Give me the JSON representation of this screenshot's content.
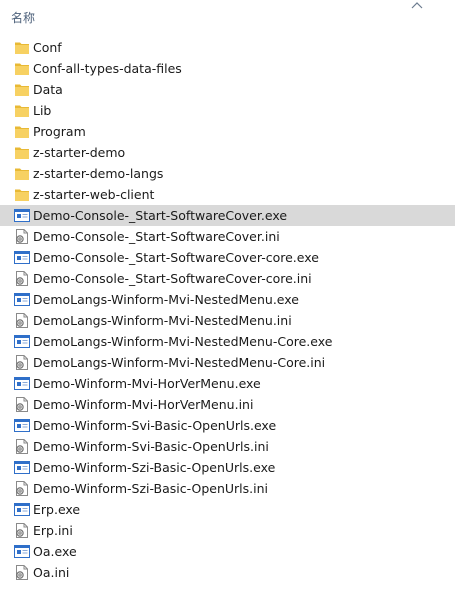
{
  "header": {
    "name_column": "名称"
  },
  "items": [
    {
      "name": "Conf",
      "type": "folder"
    },
    {
      "name": "Conf-all-types-data-files",
      "type": "folder"
    },
    {
      "name": "Data",
      "type": "folder"
    },
    {
      "name": "Lib",
      "type": "folder"
    },
    {
      "name": "Program",
      "type": "folder"
    },
    {
      "name": "z-starter-demo",
      "type": "folder"
    },
    {
      "name": "z-starter-demo-langs",
      "type": "folder"
    },
    {
      "name": "z-starter-web-client",
      "type": "folder"
    },
    {
      "name": "Demo-Console-_Start-SoftwareCover.exe",
      "type": "exe",
      "selected": true
    },
    {
      "name": "Demo-Console-_Start-SoftwareCover.ini",
      "type": "ini"
    },
    {
      "name": "Demo-Console-_Start-SoftwareCover-core.exe",
      "type": "exe"
    },
    {
      "name": "Demo-Console-_Start-SoftwareCover-core.ini",
      "type": "ini"
    },
    {
      "name": "DemoLangs-Winform-Mvi-NestedMenu.exe",
      "type": "exe"
    },
    {
      "name": "DemoLangs-Winform-Mvi-NestedMenu.ini",
      "type": "ini"
    },
    {
      "name": "DemoLangs-Winform-Mvi-NestedMenu-Core.exe",
      "type": "exe"
    },
    {
      "name": "DemoLangs-Winform-Mvi-NestedMenu-Core.ini",
      "type": "ini"
    },
    {
      "name": "Demo-Winform-Mvi-HorVerMenu.exe",
      "type": "exe"
    },
    {
      "name": "Demo-Winform-Mvi-HorVerMenu.ini",
      "type": "ini"
    },
    {
      "name": "Demo-Winform-Svi-Basic-OpenUrls.exe",
      "type": "exe"
    },
    {
      "name": "Demo-Winform-Svi-Basic-OpenUrls.ini",
      "type": "ini"
    },
    {
      "name": "Demo-Winform-Szi-Basic-OpenUrls.exe",
      "type": "exe"
    },
    {
      "name": "Demo-Winform-Szi-Basic-OpenUrls.ini",
      "type": "ini"
    },
    {
      "name": "Erp.exe",
      "type": "exe"
    },
    {
      "name": "Erp.ini",
      "type": "ini"
    },
    {
      "name": "Oa.exe",
      "type": "exe"
    },
    {
      "name": "Oa.ini",
      "type": "ini"
    }
  ],
  "colors": {
    "selected_row": "#d9d9d9",
    "folder": "#f3c545",
    "exe_blue": "#2f6fc9"
  }
}
